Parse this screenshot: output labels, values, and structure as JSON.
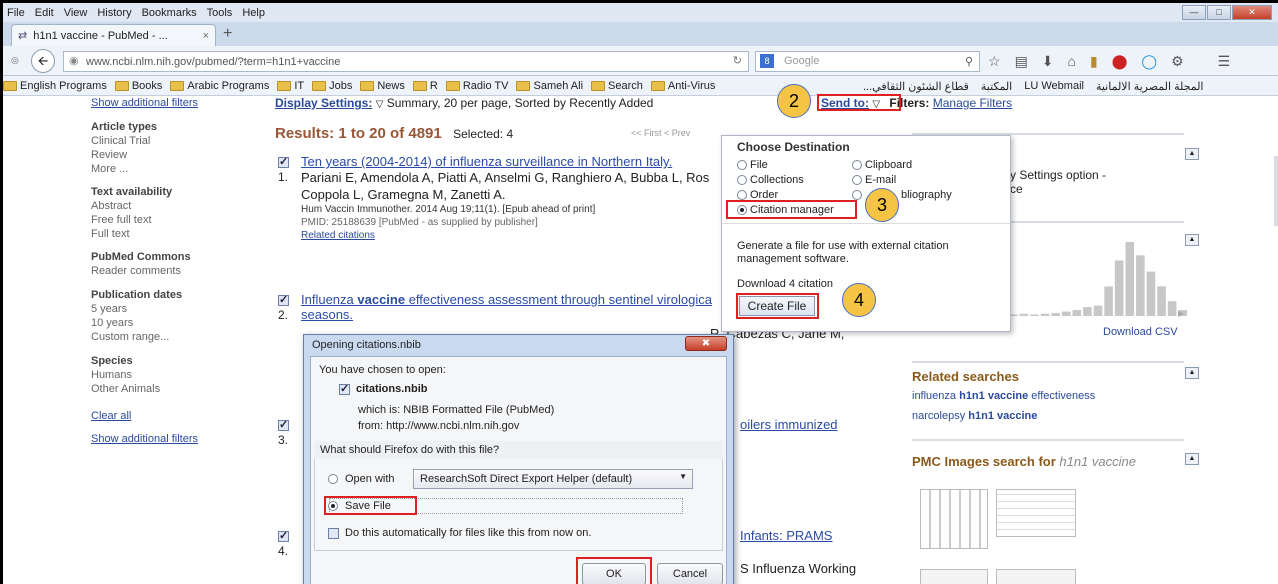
{
  "menubar": {
    "items": [
      "File",
      "Edit",
      "View",
      "History",
      "Bookmarks",
      "Tools",
      "Help"
    ]
  },
  "tab": {
    "title": "h1n1 vaccine - PubMed - ...",
    "close": "×",
    "new": "+"
  },
  "nav": {
    "url": "www.ncbi.nlm.nih.gov/pubmed/?term=h1n1+vaccine",
    "search_placeholder": "Google"
  },
  "bookmarks": {
    "left": [
      "English Programs",
      "Books",
      "Arabic Programs",
      "IT",
      "Jobs",
      "News",
      "R",
      "Radio TV",
      "Sameh Ali",
      "Search",
      "Anti-Virus"
    ],
    "right": [
      "...قطاع الشئون الثقافي",
      "المكتبة",
      "LU Webmail",
      "المجلة المصرية الالمانية"
    ]
  },
  "sidebar": {
    "show_filters_top": "Show additional filters",
    "groups": [
      {
        "title": "Article types",
        "items": [
          "Clinical Trial",
          "Review",
          "More ..."
        ]
      },
      {
        "title": "Text availability",
        "items": [
          "Abstract",
          "Free full text",
          "Full text"
        ]
      },
      {
        "title": "PubMed Commons",
        "items": [
          "Reader comments"
        ]
      },
      {
        "title": "Publication dates",
        "items": [
          "5 years",
          "10 years",
          "Custom range..."
        ]
      },
      {
        "title": "Species",
        "items": [
          "Humans",
          "Other Animals"
        ]
      }
    ],
    "clear_all": "Clear all",
    "show_filters_bottom": "Show additional filters"
  },
  "main": {
    "display_settings": "Display Settings:",
    "display_value": "Summary, 20 per page, Sorted by Recently Added",
    "send_to": "Send to:",
    "filters_label": "Filters:",
    "manage_filters": "Manage Filters",
    "results": "Results: 1 to 20 of 4891",
    "selected": "Selected: 4",
    "pager": "<< First  < Prev",
    "r1": {
      "num": "1.",
      "title": "Ten years (2004-2014) of influenza surveillance in Northern Italy.",
      "authors1": "Pariani E, Amendola A, Piatti A, Anselmi G, Ranghiero A, Bubba L, Ros",
      "authors2": "Coppola L, Gramegna M, Zanetti A.",
      "source": "Hum Vaccin Immunother. 2014 Aug 19;11(1). [Epub ahead of print]",
      "pmid": "PMID: 25188639 [PubMed - as supplied by publisher]",
      "related": "Related citations"
    },
    "r2": {
      "num": "2.",
      "title_a": "Influenza ",
      "title_b": "vaccine",
      "title_c": " effectiveness assessment through sentinel virologica",
      "title_d": "seasons.",
      "authors_tail": "R, Cabezas C, Jané M,"
    },
    "r3": {
      "num": "3.",
      "title_tail": "oilers immunized"
    },
    "r4": {
      "num": "4.",
      "title_tail": "Infants: PRAMS",
      "authors_tail": "S Influenza Working"
    }
  },
  "right": {
    "settings_text1": "y Settings option -",
    "settings_text2": "ce",
    "download_csv": "Download CSV",
    "related_title": "Related searches",
    "related1_pre": "influenza ",
    "related1_bold": "h1n1 vaccine",
    "related1_post": " effectiveness",
    "related2_pre": "narcolepsy ",
    "related2_bold": "h1n1 vaccine",
    "pmc_title": "PMC Images search for ",
    "pmc_term": "h1n1 vaccine",
    "chart_bars": [
      2,
      3,
      2,
      3,
      4,
      6,
      8,
      12,
      14,
      40,
      75,
      100,
      82,
      60,
      40,
      20,
      8
    ]
  },
  "popover": {
    "title": "Choose Destination",
    "options": [
      {
        "label": "File",
        "checked": false
      },
      {
        "label": "Clipboard",
        "checked": false
      },
      {
        "label": "Collections",
        "checked": false
      },
      {
        "label": "E-mail",
        "checked": false
      },
      {
        "label": "Order",
        "checked": false
      },
      {
        "label": "bliography",
        "checked": false
      },
      {
        "label": "Citation manager",
        "checked": true
      }
    ],
    "description": "Generate a file for use with external citation management software.",
    "download": "Download 4 citation",
    "create_button": "Create File"
  },
  "dialog": {
    "title": "Opening citations.nbib",
    "intro": "You have chosen to open:",
    "filename": "citations.nbib",
    "which_is": "which is:  NBIB Formatted File (PubMed)",
    "from": "from:  http://www.ncbi.nlm.nih.gov",
    "question": "What should Firefox do with this file?",
    "open_with": "Open with",
    "open_with_app": "ResearchSoft Direct Export Helper (default)",
    "save_file": "Save File",
    "auto": "Do this automatically for files like this from now on.",
    "ok": "OK",
    "cancel": "Cancel"
  },
  "badges": [
    "2",
    "3",
    "4"
  ]
}
